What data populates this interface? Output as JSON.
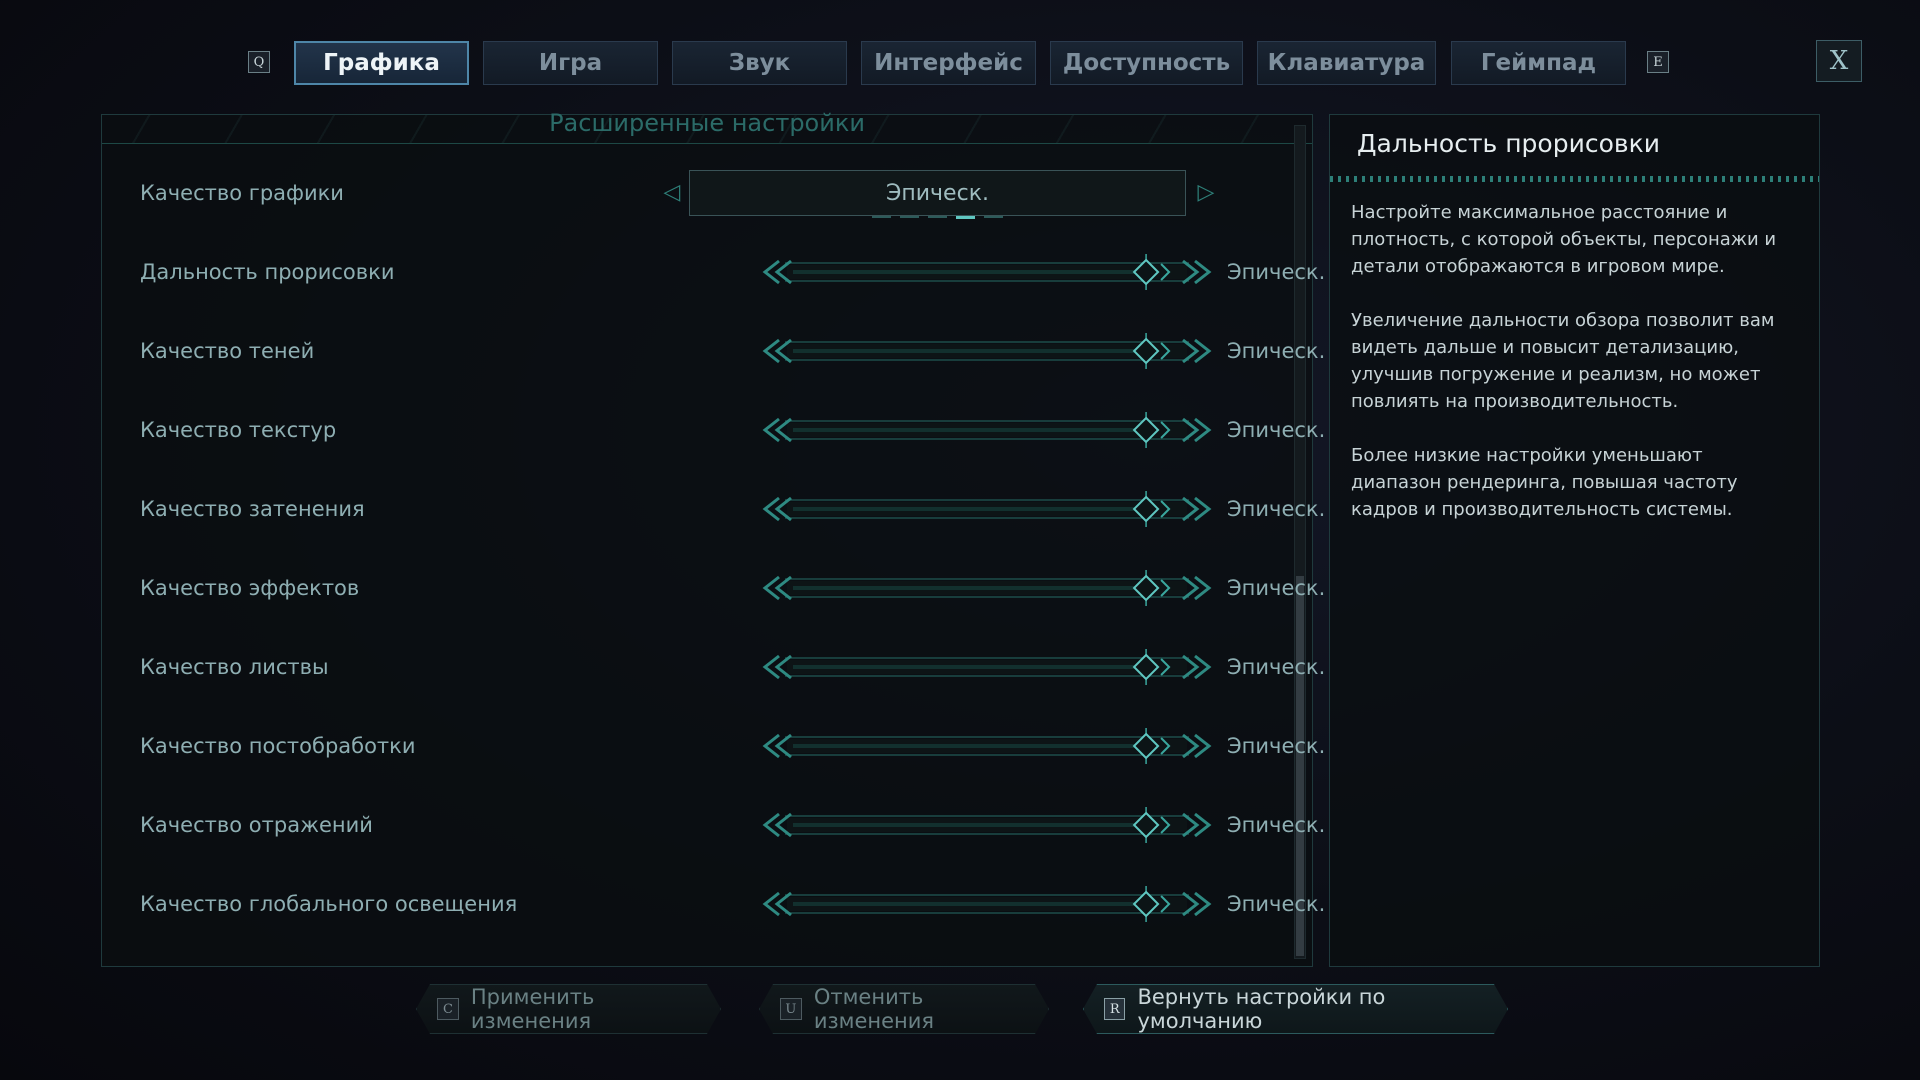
{
  "tabs": {
    "left_key": "Q",
    "right_key": "E",
    "items": [
      "Графика",
      "Игра",
      "Звук",
      "Интерфейс",
      "Доступность",
      "Клавиатура",
      "Геймпад"
    ],
    "active_index": 0,
    "close_label": "X"
  },
  "main": {
    "title": "Расширенные настройки",
    "quality": {
      "label": "Качество графики",
      "value": "Эпическ.",
      "level_count": 5,
      "selected_level_index": 3
    },
    "sliders": [
      {
        "label": "Дальность прорисовки",
        "value": "Эпическ.",
        "fraction": 0.91
      },
      {
        "label": "Качество теней",
        "value": "Эпическ.",
        "fraction": 0.91
      },
      {
        "label": "Качество текстур",
        "value": "Эпическ.",
        "fraction": 0.91
      },
      {
        "label": "Качество затенения",
        "value": "Эпическ.",
        "fraction": 0.91
      },
      {
        "label": "Качество эффектов",
        "value": "Эпическ.",
        "fraction": 0.91
      },
      {
        "label": "Качество листвы",
        "value": "Эпическ.",
        "fraction": 0.91
      },
      {
        "label": "Качество постобработки",
        "value": "Эпическ.",
        "fraction": 0.91
      },
      {
        "label": "Качество отражений",
        "value": "Эпическ.",
        "fraction": 0.91
      },
      {
        "label": "Качество глобального освещения",
        "value": "Эпическ.",
        "fraction": 0.91
      }
    ]
  },
  "info": {
    "title": "Дальность прорисовки",
    "paragraphs": [
      "Настройте максимальное расстояние и плотность, с которой объекты, персонажи и детали отображаются в игровом мире.",
      "Увеличение дальности обзора позволит вам видеть дальше и повысит детализацию, улучшив погружение и реализм, но может повлиять на производительность.",
      "Более низкие настройки уменьшают диапазон рендеринга, повышая частоту кадров и производительность системы."
    ]
  },
  "footer": {
    "apply": {
      "key": "C",
      "label": "Применить изменения"
    },
    "cancel": {
      "key": "U",
      "label": "Отменить изменения"
    },
    "reset": {
      "key": "R",
      "label": "Вернуть настройки по умолчанию"
    }
  },
  "colors": {
    "accent": "#2e9a90",
    "accent_bright": "#5fc7c1",
    "tab_active_border": "#4e86a8"
  }
}
